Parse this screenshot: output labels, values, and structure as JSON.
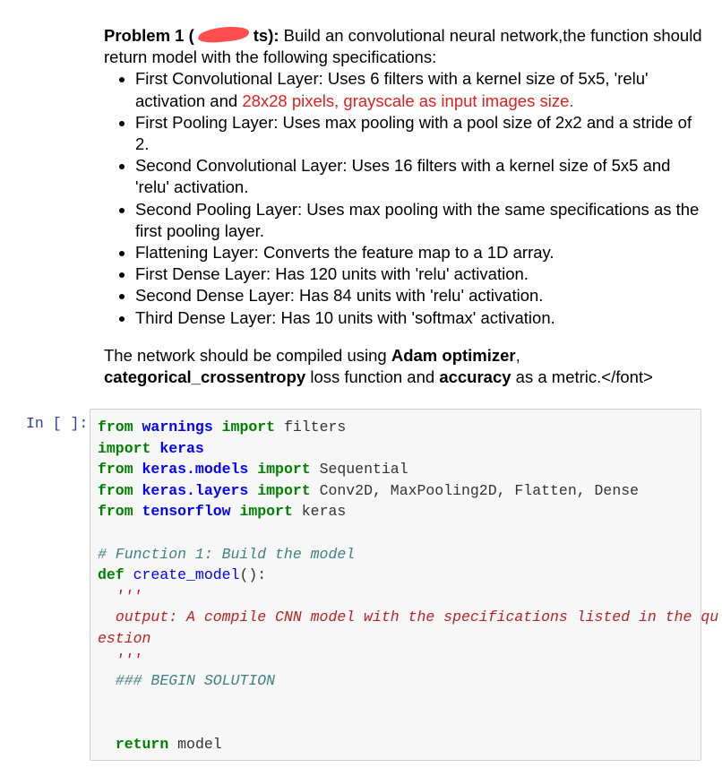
{
  "problem": {
    "title_visible_start": "Problem 1 (",
    "title_visible_end": "ts):",
    "intro": " Build an convolutional neural network,the function should return model with the following specifications:",
    "bullets": [
      {
        "text": "First Convolutional Layer: Uses 6 filters with a kernel size of 5x5, 'relu' activation and ",
        "highlight": "28x28 pixels, grayscale as input images size."
      },
      {
        "text": "First Pooling Layer: Uses max pooling with a pool size of 2x2 and a stride of 2."
      },
      {
        "text": "Second Convolutional Layer: Uses 16 filters with a kernel size of 5x5 and 'relu' activation."
      },
      {
        "text": "Second Pooling Layer: Uses max pooling with the same specifications as the first pooling layer."
      },
      {
        "text": "Flattening Layer: Converts the feature map to a 1D array."
      },
      {
        "text": "First Dense Layer: Has 120 units with 'relu' activation."
      },
      {
        "text": "Second Dense Layer: Has 84 units with 'relu' activation."
      },
      {
        "text": "Third Dense Layer: Has 10 units with 'softmax' activation."
      }
    ],
    "compile": {
      "t1": "The network should be compiled using ",
      "b1": "Adam optimizer",
      "t2": ", ",
      "b2": "categorical_crossentropy",
      "t3": " loss function and ",
      "b3": "accuracy",
      "t4": " as a metric.</font>"
    },
    "highlight_color": "#e0201e"
  },
  "cell": {
    "prompt": "In [ ]:",
    "lines": [
      [
        [
          "kw",
          "from"
        ],
        [
          "t",
          " "
        ],
        [
          "nn",
          "warnings"
        ],
        [
          "t",
          " "
        ],
        [
          "kw",
          "import"
        ],
        [
          "t",
          " filters"
        ]
      ],
      [
        [
          "kw",
          "import"
        ],
        [
          "t",
          " "
        ],
        [
          "nn",
          "keras"
        ]
      ],
      [
        [
          "kw",
          "from"
        ],
        [
          "t",
          " "
        ],
        [
          "nn",
          "keras.models"
        ],
        [
          "t",
          " "
        ],
        [
          "kw",
          "import"
        ],
        [
          "t",
          " Sequential"
        ]
      ],
      [
        [
          "kw",
          "from"
        ],
        [
          "t",
          " "
        ],
        [
          "nn",
          "keras.layers"
        ],
        [
          "t",
          " "
        ],
        [
          "kw",
          "import"
        ],
        [
          "t",
          " Conv2D, MaxPooling2D, Flatten, Dense"
        ]
      ],
      [
        [
          "kw",
          "from"
        ],
        [
          "t",
          " "
        ],
        [
          "nn",
          "tensorflow"
        ],
        [
          "t",
          " "
        ],
        [
          "kw",
          "import"
        ],
        [
          "t",
          " keras"
        ]
      ],
      [],
      [
        [
          "cm",
          "# Function 1: Build the model"
        ]
      ],
      [
        [
          "kw",
          "def"
        ],
        [
          "t",
          " "
        ],
        [
          "nf",
          "create_model"
        ],
        [
          "t",
          "():"
        ]
      ],
      [
        [
          "t",
          "  "
        ],
        [
          "sd",
          "'''"
        ]
      ],
      [
        [
          "t",
          "  "
        ],
        [
          "sd",
          "output: A compile CNN model with the specifications listed in the qu"
        ]
      ],
      [
        [
          "sd",
          "estion"
        ]
      ],
      [
        [
          "t",
          "  "
        ],
        [
          "sd",
          "'''"
        ]
      ],
      [
        [
          "t",
          "  "
        ],
        [
          "cm",
          "### BEGIN SOLUTION"
        ]
      ],
      [],
      [],
      [
        [
          "t",
          "  "
        ],
        [
          "kw",
          "return"
        ],
        [
          "t",
          " model"
        ]
      ]
    ]
  }
}
